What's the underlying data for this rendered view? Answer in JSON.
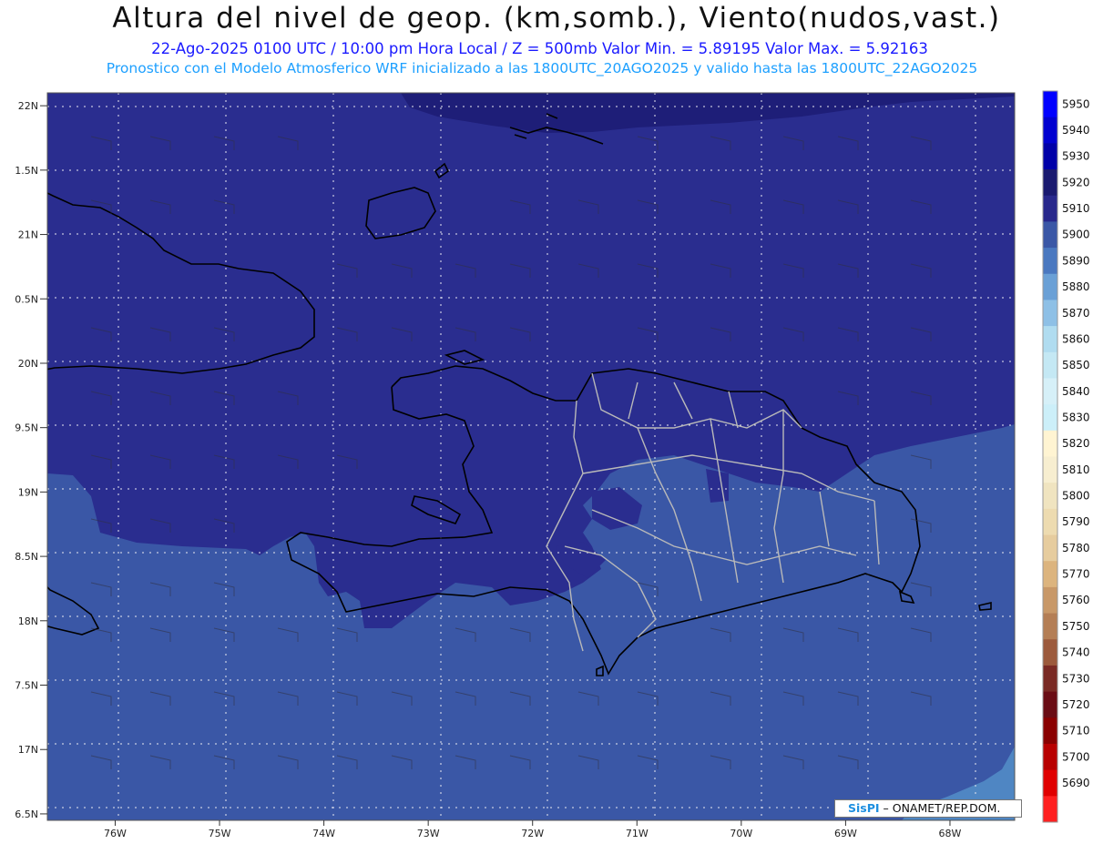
{
  "header": {
    "title": "Altura del nivel de geop. (km,somb.), Viento(nudos,vast.)",
    "subtitle_line1": "22-Ago-2025  0100 UTC / 10:00 pm Hora Local / Z = 500mb    Valor Min. = 5.89195  Valor Max. = 5.92163",
    "subtitle_line2": "Pronostico con el Modelo Atmosferico WRF inicializado a las 1800UTC_20AGO2025 y valido hasta las  1800UTC_22AGO2025"
  },
  "map": {
    "lon_range": [
      -76.65,
      -67.38
    ],
    "lat_range": [
      16.45,
      22.1
    ],
    "lat_ticks": [
      "22N",
      "1.5N",
      "21N",
      "0.5N",
      "20N",
      "9.5N",
      "19N",
      "8.5N",
      "18N",
      "7.5N",
      "17N",
      "6.5N"
    ],
    "lon_ticks": [
      "76W",
      "75W",
      "74W",
      "73W",
      "72W",
      "71W",
      "70W",
      "69W",
      "68W"
    ],
    "colors": {
      "background_fill": "#2a2d8f",
      "lower_fill": "#3a57a6",
      "upper_fill": "#1e1e78",
      "corner_fill": "#4f86c3",
      "coastline": "#000000",
      "province_lines": "#b9b9b9",
      "gridline": "#e8e8f0"
    }
  },
  "colorbar": {
    "levels": [
      5950,
      5940,
      5930,
      5920,
      5910,
      5900,
      5890,
      5880,
      5870,
      5860,
      5850,
      5840,
      5830,
      5820,
      5810,
      5800,
      5790,
      5780,
      5770,
      5760,
      5750,
      5740,
      5730,
      5720,
      5710,
      5700,
      5690
    ],
    "colors": [
      "#0000ff",
      "#0000d0",
      "#0000a8",
      "#1a1a70",
      "#28288c",
      "#3a57a6",
      "#4a78c0",
      "#6aa0d6",
      "#8ec0e6",
      "#b0dcf0",
      "#c4e8f4",
      "#d6f0f8",
      "#cceff9",
      "#fff4d2",
      "#f7eed0",
      "#f0e4c0",
      "#eddbb0",
      "#e6cc9e",
      "#dcb47e",
      "#c89868",
      "#b47e55",
      "#9c5a3c",
      "#7a2a24",
      "#6a0c14",
      "#8a0000",
      "#b80000",
      "#e00000",
      "#ff2020"
    ]
  },
  "logo": {
    "brand": "SisPI",
    "text": " – ONAMET/REP.DOM."
  }
}
